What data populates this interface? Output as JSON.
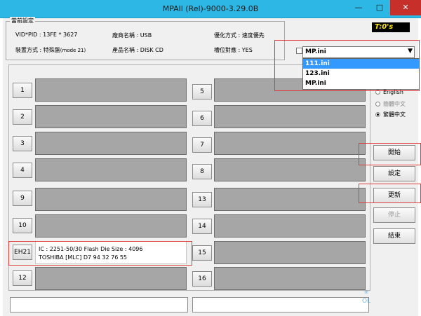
{
  "window": {
    "title": "MPAll (Rel)-9000-3.29.0B",
    "minimize": "—",
    "maximize": "□",
    "close": "✕"
  },
  "settings": {
    "group_title": "當前設定",
    "vidpid": "VID*PID : 13FE * 3627",
    "vendor": "廠商名稱 : USB",
    "opt_mode": "優化方式 : 速度優先",
    "device_mode_prefix": "裝置方式 : 特殊盤",
    "device_mode_suffix": "(mode 21)",
    "product": "產品名稱 : DISK CD",
    "slot_map": "槽位對應 : YES"
  },
  "timer": "T:0's",
  "ini": {
    "selected": "MP.ini",
    "options": [
      "111.ini",
      "123.ini",
      "MP.ini"
    ],
    "highlighted": "111.ini"
  },
  "language": {
    "english": "English",
    "simplified": "簡體中文",
    "traditional": "繁體中文"
  },
  "ports": {
    "left": [
      {
        "label": "1"
      },
      {
        "label": "2"
      },
      {
        "label": "3"
      },
      {
        "label": "4"
      },
      {
        "label": "9"
      },
      {
        "label": "10"
      },
      {
        "label": "EH21"
      },
      {
        "label": "12"
      }
    ],
    "right": [
      {
        "label": "5"
      },
      {
        "label": "6"
      },
      {
        "label": "7"
      },
      {
        "label": "8"
      },
      {
        "label": "13"
      },
      {
        "label": "14"
      },
      {
        "label": "15"
      },
      {
        "label": "16"
      }
    ],
    "eh21_line1": "IC : 2251-50/30  Flash Die Size : 4096",
    "eh21_line2": "TOSHIBA [MLC] D7 94 32 76 55"
  },
  "actions": {
    "start": "開始",
    "settings": "設定",
    "update": "更新",
    "stop": "停止",
    "exit": "結束"
  }
}
